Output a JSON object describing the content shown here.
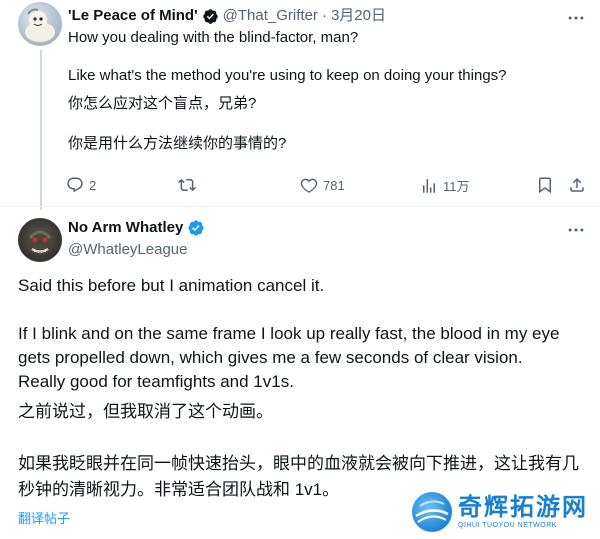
{
  "tweet1": {
    "display_name": "'Le Peace of Mind'",
    "handle": "@That_Grifter",
    "separator": "·",
    "date": "3月20日",
    "lines": [
      "How you dealing with the blind-factor, man?",
      "Like what's the method you're using to keep on doing your things?",
      "你怎么应对这个盲点，兄弟?",
      "你是用什么方法继续你的事情的?"
    ],
    "actions": {
      "replies": "2",
      "likes": "781",
      "views": "11万"
    }
  },
  "tweet2": {
    "display_name": "No Arm Whatley",
    "handle": "@WhatleyLeague",
    "lines": [
      "Said this before but I animation cancel it.",
      "If I blink and on the same frame I look up really fast, the blood in my eye",
      "gets propelled down, which gives me a few seconds of clear vision.",
      "Really good for teamfights and 1v1s.",
      "之前说过，但我取消了这个动画。",
      "如果我眨眼并在同一帧快速抬头，眼中的血液就会被向下推进，这让我有几",
      "秒钟的清晰视力。非常适合团队战和 1v1。"
    ],
    "translate_link": "翻译帖子"
  },
  "watermark": {
    "chinese": "奇辉拓游网",
    "english": "QIHUI TUOYOU NETWORK"
  },
  "colors": {
    "text": "#0f1419",
    "secondary": "#536471",
    "link": "#1d9bf0",
    "verified": "#1d9bf0",
    "divider": "#eff3f4"
  },
  "icons": [
    "more-icon",
    "reply-icon",
    "retweet-icon",
    "like-icon",
    "views-icon",
    "bookmark-icon",
    "share-icon",
    "verified-badge-icon"
  ]
}
